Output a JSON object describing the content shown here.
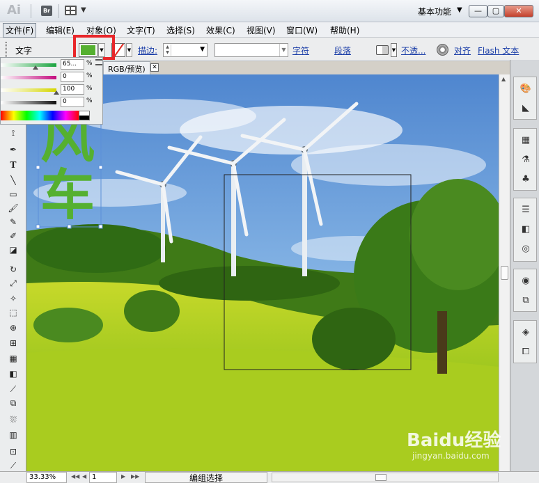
{
  "app": {
    "logo": "Ai",
    "bridge": "Br",
    "workspace": "基本功能"
  },
  "window_buttons": {
    "minimize": "—",
    "restore": "▢",
    "close": "✕"
  },
  "menu": [
    "文件(F)",
    "编辑(E)",
    "对象(O)",
    "文字(T)",
    "选择(S)",
    "效果(C)",
    "视图(V)",
    "窗口(W)",
    "帮助(H)"
  ],
  "control_bar": {
    "context_label": "文字",
    "fill_color": "#55b030",
    "stroke_label": "描边:",
    "char_link": "字符",
    "para_link": "段落",
    "opacity_link": "不透...",
    "align_link": "对齐",
    "flash_link": "Flash 文本"
  },
  "color_panel": {
    "rows": [
      {
        "value": "65...",
        "unit": "%",
        "fill": 0.65,
        "color": "#19a33e"
      },
      {
        "value": "0",
        "unit": "%",
        "fill": 0.0,
        "color": "#c40b7e"
      },
      {
        "value": "100",
        "unit": "%",
        "fill": 1.0,
        "color": "#d5d600"
      },
      {
        "value": "0",
        "unit": "%",
        "fill": 0.0,
        "color": "#111111"
      }
    ]
  },
  "document_tab": {
    "label": "RGB/预览)",
    "close": "✕"
  },
  "artwork_text": {
    "line1": "风",
    "line2": "车"
  },
  "status": {
    "zoom": "33.33%",
    "page": "1",
    "status_text": "编组选择"
  },
  "watermark": {
    "brand": "Baidu经验",
    "url": "jingyan.baidu.com"
  }
}
